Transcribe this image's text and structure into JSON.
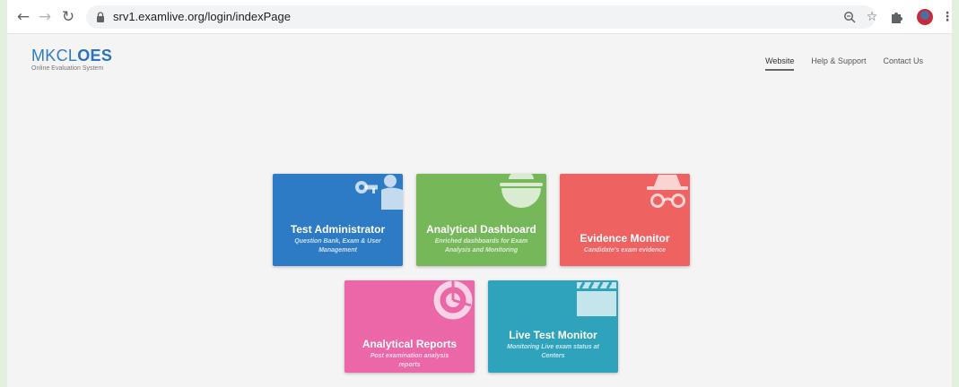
{
  "browser": {
    "url": "srv1.examlive.org/login/indexPage"
  },
  "logo": {
    "main_light": "MKCL",
    "main_bold": "OES",
    "subtitle": "Online Evaluation System"
  },
  "nav": {
    "items": [
      {
        "label": "Website",
        "active": true
      },
      {
        "label": "Help & Support",
        "active": false
      },
      {
        "label": "Contact Us",
        "active": false
      }
    ]
  },
  "tiles": [
    {
      "title": "Test Administrator",
      "desc": "Question Bank, Exam & User Management",
      "color": "#2d7bc5",
      "icon": "key-user-icon"
    },
    {
      "title": "Analytical Dashboard",
      "desc": "Enriched dashboards for Exam Analysis and Monitoring",
      "color": "#76b75a",
      "icon": "bowl-icon"
    },
    {
      "title": "Evidence Monitor",
      "desc": "Candidate's exam evidence",
      "color": "#ee6262",
      "icon": "spy-icon"
    },
    {
      "title": "Analytical Reports",
      "desc": "Post examination analysis reports",
      "color": "#ec67a7",
      "icon": "chart-donut-icon"
    },
    {
      "title": "Live Test Monitor",
      "desc": "Monitoring Live exam status at Centers",
      "color": "#2fa3bb",
      "icon": "clapperboard-icon"
    }
  ]
}
